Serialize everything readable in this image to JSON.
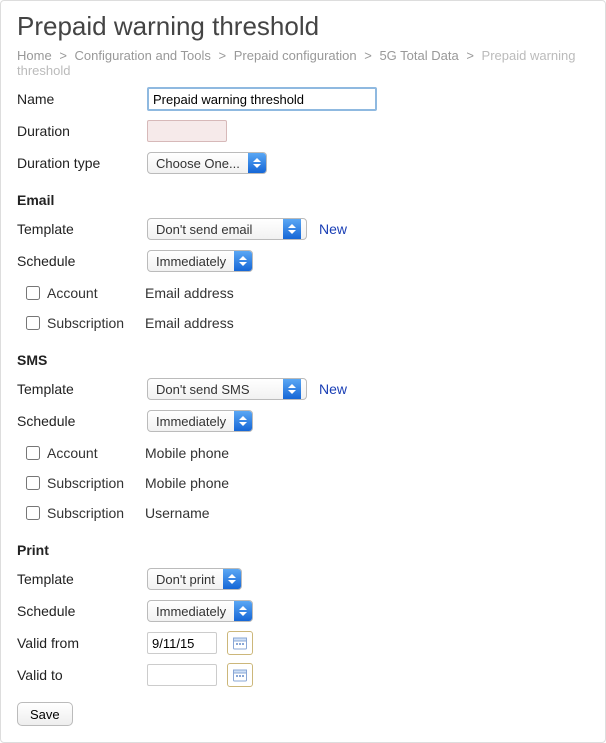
{
  "page": {
    "title": "Prepaid warning threshold"
  },
  "breadcrumb": {
    "home": "Home",
    "config_tools": "Configuration and Tools",
    "prepaid_config": "Prepaid configuration",
    "plan": "5G Total Data",
    "current": "Prepaid warning threshold",
    "sep": ">"
  },
  "form": {
    "name_label": "Name",
    "name_value": "Prepaid warning threshold",
    "duration_label": "Duration",
    "duration_value": "",
    "duration_type_label": "Duration type",
    "duration_type_value": "Choose One..."
  },
  "email": {
    "heading": "Email",
    "template_label": "Template",
    "template_value": "Don't send email",
    "new_label": "New",
    "schedule_label": "Schedule",
    "schedule_value": "Immediately",
    "rows": [
      {
        "who": "Account",
        "what": "Email address",
        "checked": false
      },
      {
        "who": "Subscription",
        "what": "Email address",
        "checked": false
      }
    ]
  },
  "sms": {
    "heading": "SMS",
    "template_label": "Template",
    "template_value": "Don't send SMS",
    "new_label": "New",
    "schedule_label": "Schedule",
    "schedule_value": "Immediately",
    "rows": [
      {
        "who": "Account",
        "what": "Mobile phone",
        "checked": false
      },
      {
        "who": "Subscription",
        "what": "Mobile phone",
        "checked": false
      },
      {
        "who": "Subscription",
        "what": "Username",
        "checked": false
      }
    ]
  },
  "print": {
    "heading": "Print",
    "template_label": "Template",
    "template_value": "Don't print",
    "schedule_label": "Schedule",
    "schedule_value": "Immediately",
    "valid_from_label": "Valid from",
    "valid_from_value": "9/11/15",
    "valid_to_label": "Valid to",
    "valid_to_value": ""
  },
  "actions": {
    "save_label": "Save"
  }
}
